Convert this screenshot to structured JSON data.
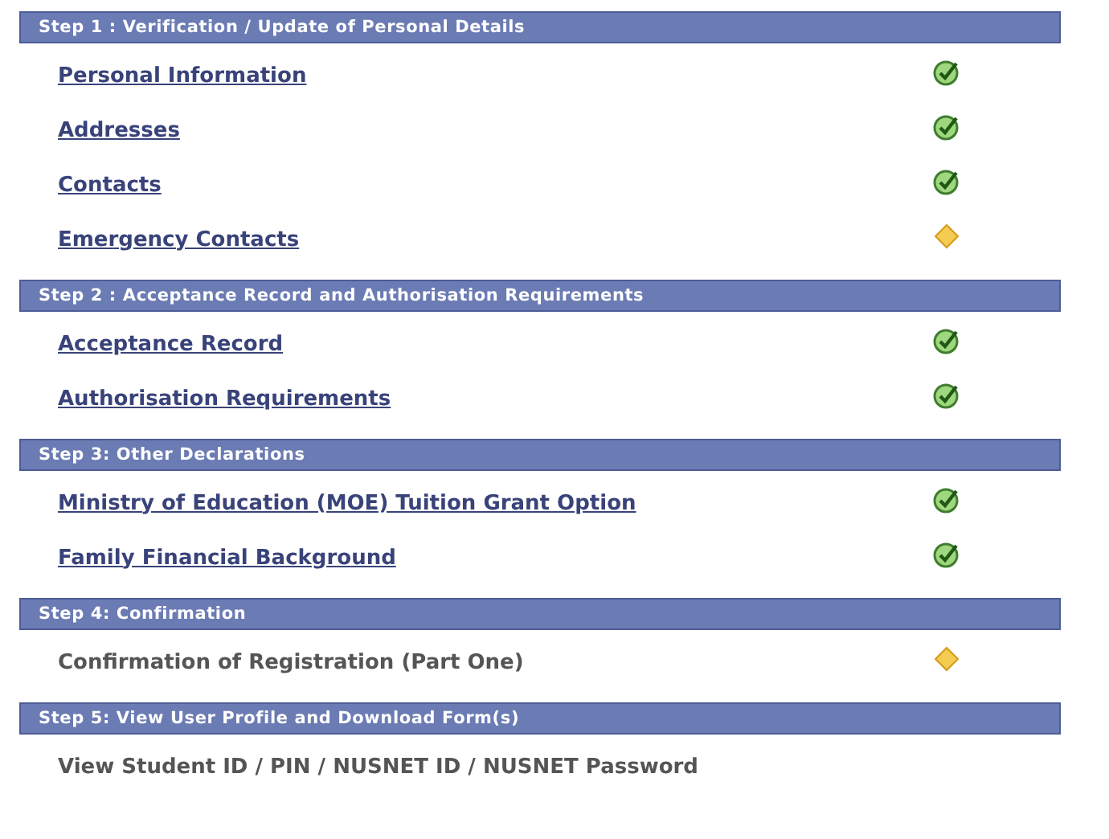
{
  "steps": [
    {
      "title": "Step 1 : Verification / Update of Personal Details",
      "items": [
        {
          "label": "Personal Information",
          "kind": "link",
          "status": {
            "kind": "complete"
          }
        },
        {
          "label": "Addresses",
          "kind": "link",
          "status": {
            "kind": "complete"
          }
        },
        {
          "label": "Contacts",
          "kind": "link",
          "status": {
            "kind": "complete"
          }
        },
        {
          "label": "Emergency Contacts",
          "kind": "link",
          "status": {
            "kind": "pending"
          }
        }
      ]
    },
    {
      "title": "Step 2 : Acceptance Record and Authorisation Requirements",
      "items": [
        {
          "label": "Acceptance Record",
          "kind": "link",
          "status": {
            "kind": "complete"
          }
        },
        {
          "label": "Authorisation Requirements",
          "kind": "link",
          "status": {
            "kind": "complete"
          }
        }
      ]
    },
    {
      "title": "Step 3: Other Declarations",
      "items": [
        {
          "label": "Ministry of Education (MOE) Tuition Grant Option",
          "kind": "link",
          "status": {
            "kind": "complete"
          }
        },
        {
          "label": "Family Financial Background",
          "kind": "link",
          "status": {
            "kind": "complete"
          }
        }
      ]
    },
    {
      "title": "Step 4: Confirmation",
      "items": [
        {
          "label": "Confirmation of Registration (Part One)",
          "kind": "text",
          "status": {
            "kind": "pending"
          }
        }
      ]
    },
    {
      "title": "Step 5: View User Profile and Download Form(s)",
      "items": [
        {
          "label": "View Student ID / PIN / NUSNET ID / NUSNET Password",
          "kind": "text"
        }
      ]
    }
  ]
}
